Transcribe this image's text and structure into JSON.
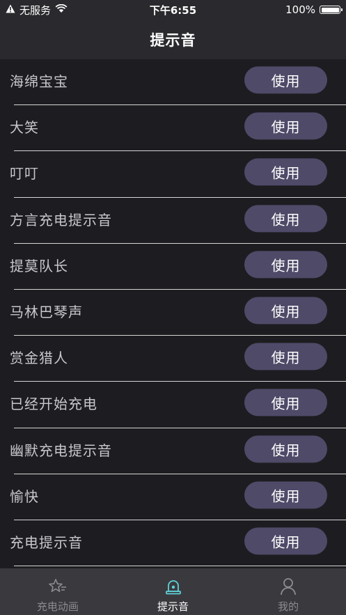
{
  "status_bar": {
    "carrier": "无服务",
    "time": "下午6:55",
    "battery": "100%"
  },
  "nav": {
    "title": "提示音"
  },
  "list": {
    "items": [
      {
        "label": "海绵宝宝",
        "button": "使用"
      },
      {
        "label": "大笑",
        "button": "使用"
      },
      {
        "label": "叮叮",
        "button": "使用"
      },
      {
        "label": "方言充电提示音",
        "button": "使用"
      },
      {
        "label": "提莫队长",
        "button": "使用"
      },
      {
        "label": "马林巴琴声",
        "button": "使用"
      },
      {
        "label": "赏金猎人",
        "button": "使用"
      },
      {
        "label": "已经开始充电",
        "button": "使用"
      },
      {
        "label": "幽默充电提示音",
        "button": "使用"
      },
      {
        "label": "愉快",
        "button": "使用"
      },
      {
        "label": "充电提示音",
        "button": "使用"
      }
    ]
  },
  "tabs": [
    {
      "label": "充电动画",
      "icon": "star-lines-icon",
      "active": false
    },
    {
      "label": "提示音",
      "icon": "alarm-bell-icon",
      "active": true
    },
    {
      "label": "我的",
      "icon": "person-icon",
      "active": false
    }
  ],
  "colors": {
    "background": "#1d1d21",
    "bar": "#2a2a2e",
    "tab_bar": "#3a3a3e",
    "button": "#4f4a68",
    "active_icon": "#5fd0d8"
  }
}
